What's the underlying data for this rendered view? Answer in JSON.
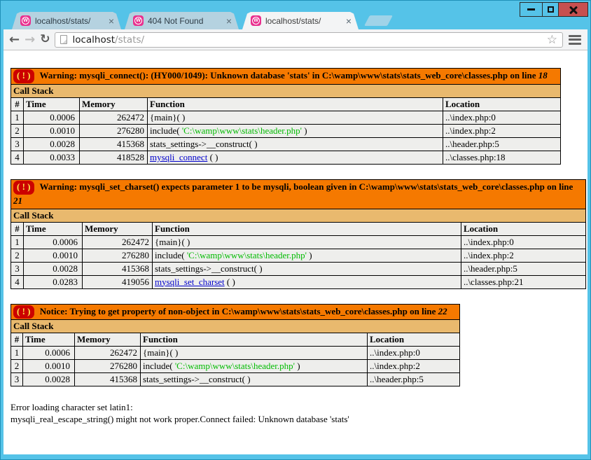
{
  "colors": {
    "chrome_blue": "#55c3e8",
    "tab_inactive": "#b5d2e0",
    "chrome_gray": "#f3f4f5",
    "close_red": "#c75050",
    "wamp_pink": "#e9308e",
    "warn_orange": "#f57900",
    "callstack_tan": "#e9b96e",
    "cell_gray": "#eeeeec",
    "icon_red": "#cc0000",
    "icon_yellow": "#fce94f",
    "string_green": "#00bb00",
    "link_blue": "#0000cc"
  },
  "icons": {
    "back": "←",
    "forward": "→",
    "reload": "↻",
    "star": "☆",
    "tab_close": "×",
    "wamp_letter": "W"
  },
  "browser": {
    "tabs": [
      {
        "label": "localhost/stats/",
        "active": false
      },
      {
        "label": "404 Not Found",
        "active": false
      },
      {
        "label": "localhost/stats/",
        "active": true
      }
    ],
    "url_host": "localhost",
    "url_path": "/stats/"
  },
  "errors": [
    {
      "icon": "( ! )",
      "message": "Warning: mysqli_connect(): (HY000/1049): Unknown database 'stats' in C:\\wamp\\www\\stats\\stats_web_core\\classes.php on line ",
      "line": "18",
      "call_stack": "Call Stack",
      "columns": [
        "#",
        "Time",
        "Memory",
        "Function",
        "Location"
      ],
      "rows": [
        [
          "1",
          "0.0006",
          "262472",
          [
            {
              "t": "{main}( )"
            }
          ],
          "..\\index.php:0"
        ],
        [
          "2",
          "0.0010",
          "276280",
          [
            {
              "t": "include( "
            },
            {
              "s": "'C:\\wamp\\www\\stats\\header.php'"
            },
            {
              "t": " )"
            }
          ],
          "..\\index.php:2"
        ],
        [
          "3",
          "0.0028",
          "415368",
          [
            {
              "t": "stats_settings->__construct( )"
            }
          ],
          "..\\header.php:5"
        ],
        [
          "4",
          "0.0033",
          "418528",
          [
            {
              "a": "mysqli_connect"
            },
            {
              "t": " ( )"
            }
          ],
          "..\\classes.php:18"
        ]
      ]
    },
    {
      "icon": "( ! )",
      "message": "Warning: mysqli_set_charset() expects parameter 1 to be mysqli, boolean given in C:\\wamp\\www\\stats\\stats_web_core\\classes.php on line ",
      "line": "21",
      "call_stack": "Call Stack",
      "columns": [
        "#",
        "Time",
        "Memory",
        "Function",
        "Location"
      ],
      "rows": [
        [
          "1",
          "0.0006",
          "262472",
          [
            {
              "t": "{main}( )"
            }
          ],
          "..\\index.php:0"
        ],
        [
          "2",
          "0.0010",
          "276280",
          [
            {
              "t": "include( "
            },
            {
              "s": "'C:\\wamp\\www\\stats\\header.php'"
            },
            {
              "t": " )"
            }
          ],
          "..\\index.php:2"
        ],
        [
          "3",
          "0.0028",
          "415368",
          [
            {
              "t": "stats_settings->__construct( )"
            }
          ],
          "..\\header.php:5"
        ],
        [
          "4",
          "0.0283",
          "419056",
          [
            {
              "a": "mysqli_set_charset"
            },
            {
              "t": " ( )"
            }
          ],
          "..\\classes.php:21"
        ]
      ]
    },
    {
      "icon": "( ! )",
      "message": "Notice: Trying to get property of non-object in C:\\wamp\\www\\stats\\stats_web_core\\classes.php on line ",
      "line": "22",
      "call_stack": "Call Stack",
      "columns": [
        "#",
        "Time",
        "Memory",
        "Function",
        "Location"
      ],
      "rows": [
        [
          "1",
          "0.0006",
          "262472",
          [
            {
              "t": "{main}( )"
            }
          ],
          "..\\index.php:0"
        ],
        [
          "2",
          "0.0010",
          "276280",
          [
            {
              "t": "include( "
            },
            {
              "s": "'C:\\wamp\\www\\stats\\header.php'"
            },
            {
              "t": " )"
            }
          ],
          "..\\index.php:2"
        ],
        [
          "3",
          "0.0028",
          "415368",
          [
            {
              "t": "stats_settings->__construct( )"
            }
          ],
          "..\\header.php:5"
        ]
      ]
    }
  ],
  "footer_lines": [
    "Error loading character set latin1:",
    "mysqli_real_escape_string() might not work proper.Connect failed: Unknown database 'stats'"
  ]
}
